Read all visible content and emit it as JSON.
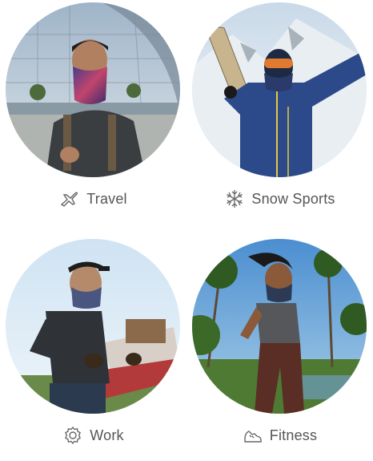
{
  "categories": [
    {
      "id": "travel",
      "label": "Travel",
      "icon": "airplane-icon"
    },
    {
      "id": "snow",
      "label": "Snow Sports",
      "icon": "snowflake-icon"
    },
    {
      "id": "work",
      "label": "Work",
      "icon": "gear-icon"
    },
    {
      "id": "fitness",
      "label": "Fitness",
      "icon": "sneaker-icon"
    }
  ],
  "colors": {
    "label_text": "#555555",
    "icon_stroke": "#666666"
  }
}
